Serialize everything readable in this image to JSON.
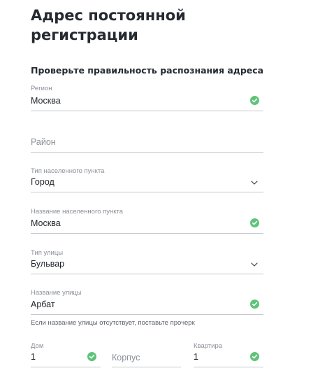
{
  "page_title": "Адрес постоянной регистрации",
  "section_title": "Проверьте правильность распознания адреса",
  "fields": {
    "region": {
      "label": "Регион",
      "value": "Москва",
      "icon": "check-circle-icon"
    },
    "district": {
      "placeholder": "Район"
    },
    "settlement_type": {
      "label": "Тип населенного пункта",
      "value": "Город",
      "icon": "chevron-down-icon"
    },
    "settlement_name": {
      "label": "Название населенного пункта",
      "value": "Москва",
      "icon": "check-circle-icon"
    },
    "street_type": {
      "label": "Тип улицы",
      "value": "Бульвар",
      "icon": "chevron-down-icon"
    },
    "street_name": {
      "label": "Название улицы",
      "value": "Арбат",
      "icon": "check-circle-icon"
    },
    "house": {
      "label": "Дом",
      "value": "1",
      "icon": "check-circle-icon"
    },
    "building": {
      "placeholder": "Корпус"
    },
    "apartment": {
      "label": "Квартира",
      "value": "1",
      "icon": "check-circle-icon"
    }
  },
  "street_hint": "Если название улицы отсутствует, поставьте прочерк",
  "colors": {
    "accent_valid": "#5fc47a",
    "label": "#8a8f97",
    "text": "#1f2329",
    "underline": "#c6c8cc"
  }
}
